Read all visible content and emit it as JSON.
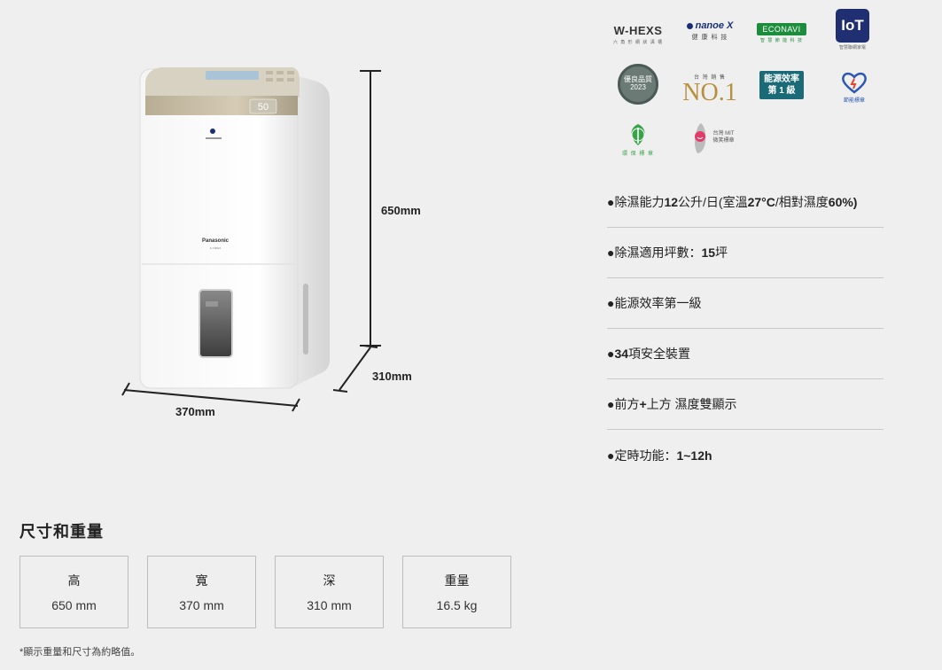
{
  "product": {
    "display_reading": "50",
    "brand_label": "Panasonic",
    "model_label": "F-Y28GX"
  },
  "dimensions_diagram": {
    "height_label": "650mm",
    "depth_label": "310mm",
    "width_label": "370mm"
  },
  "badges": {
    "whexs": {
      "name": "W-HEXS",
      "sub": "六 角 形 網 狀 溝 槽"
    },
    "nanoe": {
      "name": "nanoe X",
      "sub": "健 康 科 技"
    },
    "econavi": {
      "name": "ECONAVI",
      "sub": "智 慧 節 能 科 技"
    },
    "iot": {
      "name": "IoT",
      "sub": "智慧聯網家電"
    },
    "award": {
      "name": "優良品質",
      "sub": "2023"
    },
    "no1": {
      "name": "NO.1",
      "sub": "台 灣 銷 售"
    },
    "energy": {
      "line1": "能源效率",
      "line2": "第 1 級"
    },
    "saving": {
      "sub": "節能標章"
    },
    "eco": {
      "sub": "環 保 標 章"
    },
    "mit": {
      "line1": "台灣 MIT",
      "line2": "微笑標章"
    }
  },
  "features": [
    {
      "prefix": "●除濕能力",
      "bold1": "12",
      "mid": "公升/日(室溫",
      "bold2": "27°C",
      "mid2": "/相對濕度",
      "bold3": "60%)"
    },
    {
      "prefix": "●除濕適用坪數：",
      "bold1": "15",
      "mid": "坪",
      "bold2": "",
      "mid2": "",
      "bold3": ""
    },
    {
      "prefix": "●能源效率第一級",
      "bold1": "",
      "mid": "",
      "bold2": "",
      "mid2": "",
      "bold3": ""
    },
    {
      "prefix": "●",
      "bold1": "34",
      "mid": "項安全裝置",
      "bold2": "",
      "mid2": "",
      "bold3": ""
    },
    {
      "prefix": "●前方",
      "bold1": "+",
      "mid": "上方 濕度雙顯示",
      "bold2": "",
      "mid2": "",
      "bold3": ""
    },
    {
      "prefix": "●定時功能：",
      "bold1": "1~12h",
      "mid": "",
      "bold2": "",
      "mid2": "",
      "bold3": ""
    }
  ],
  "specs": {
    "title": "尺寸和重量",
    "items": [
      {
        "label": "高",
        "value": "650 mm"
      },
      {
        "label": "寬",
        "value": "370 mm"
      },
      {
        "label": "深",
        "value": "310 mm"
      },
      {
        "label": "重量",
        "value": "16.5 kg"
      }
    ],
    "footnote": "*顯示重量和尺寸為約略值。"
  },
  "colors": {
    "background": "#efefef",
    "panel_gold": "#c9bfa8",
    "iot_blue": "#1f2f72",
    "econavi_green": "#1c8c3d",
    "energy_teal": "#1b6a77",
    "no1_gold": "#b7903f"
  }
}
